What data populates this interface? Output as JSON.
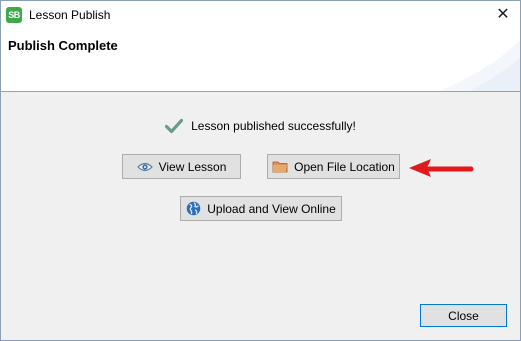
{
  "window": {
    "title": "Lesson Publish",
    "app_icon_text": "SB",
    "close_glyph": "✕"
  },
  "header": {
    "title": "Publish Complete"
  },
  "status": {
    "message": "Lesson published successfully!",
    "icon": "checkmark-icon"
  },
  "buttons": {
    "view_lesson": "View Lesson",
    "open_file_location": "Open File Location",
    "upload_view_online": "Upload and View Online",
    "close": "Close"
  },
  "icons": {
    "view": "eye-icon",
    "open": "folder-icon",
    "upload": "globe-icon",
    "annotation": "red-arrow-icon"
  },
  "colors": {
    "check": "#6a9a8a",
    "arrow": "#e0191b",
    "globe": "#2e6fba",
    "folder": "#c8763a"
  }
}
